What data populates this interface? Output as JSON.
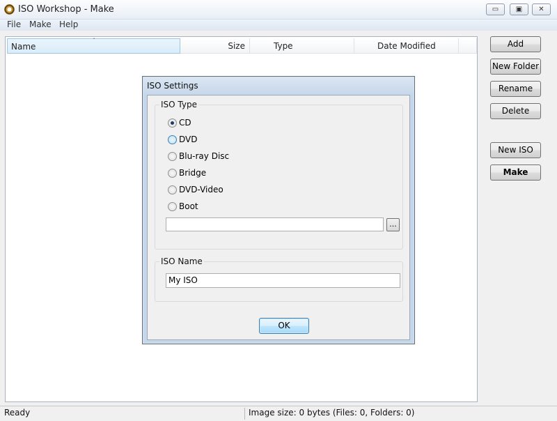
{
  "window": {
    "title": "ISO Workshop - Make",
    "icon": "disc-icon",
    "controls": {
      "minimize": "▭",
      "maximize": "▣",
      "close": "✕"
    }
  },
  "menu": [
    "File",
    "Make",
    "Help"
  ],
  "file_list": {
    "columns": [
      "Name",
      "Size",
      "Type",
      "Date Modified"
    ],
    "sort_indicator": "ˆ",
    "rows": []
  },
  "side_buttons": {
    "add": "Add",
    "new_folder": "New Folder",
    "rename": "Rename",
    "delete": "Delete",
    "new_iso": "New ISO",
    "make": "Make"
  },
  "status": {
    "left": "Ready",
    "right": "Image size: 0 bytes (Files: 0, Folders: 0)"
  },
  "dialog": {
    "title": "ISO Settings",
    "iso_type_label": "ISO Type",
    "options": [
      "CD",
      "DVD",
      "Blu-ray Disc",
      "Bridge",
      "DVD-Video",
      "Boot"
    ],
    "selected": "CD",
    "boot_path_value": "",
    "browse_label": "...",
    "iso_name_label": "ISO Name",
    "iso_name_value": "My ISO",
    "ok_label": "OK"
  }
}
